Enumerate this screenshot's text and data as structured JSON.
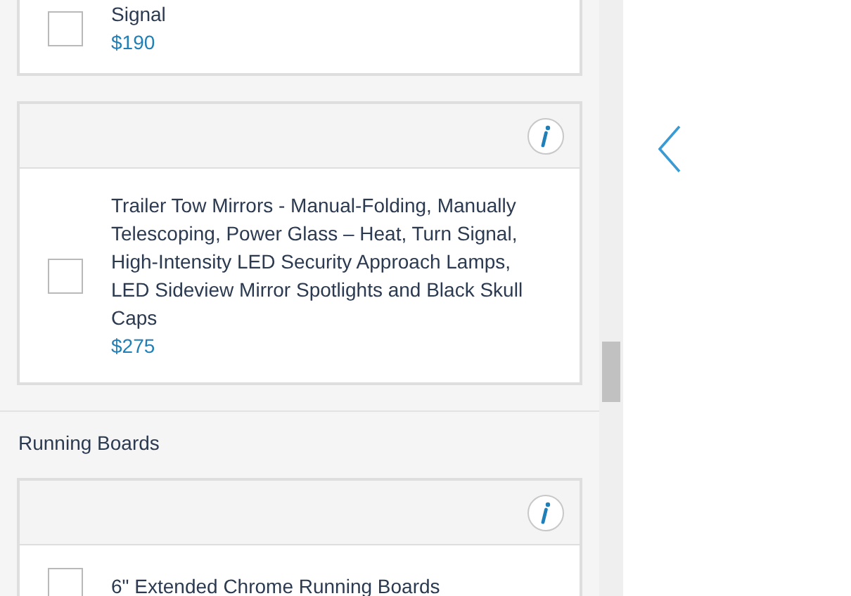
{
  "groups": [
    {
      "cards": [
        {
          "description": "Signal",
          "price": "$190",
          "checked": false,
          "info_button": false
        }
      ]
    },
    {
      "cards": [
        {
          "description": "Trailer Tow Mirrors - Manual-Folding, Manually Telescoping, Power Glass – Heat, Turn Signal, High-Intensity LED Security Approach Lamps, LED Sideview Mirror Spotlights and Black Skull Caps",
          "price": "$275",
          "checked": false,
          "info_button": true
        }
      ]
    },
    {
      "title": "Running Boards",
      "cards": [
        {
          "description": "6\" Extended Chrome Running Boards",
          "checked": false,
          "info_button": true
        }
      ]
    }
  ],
  "carousel": {
    "previous_button": true
  }
}
